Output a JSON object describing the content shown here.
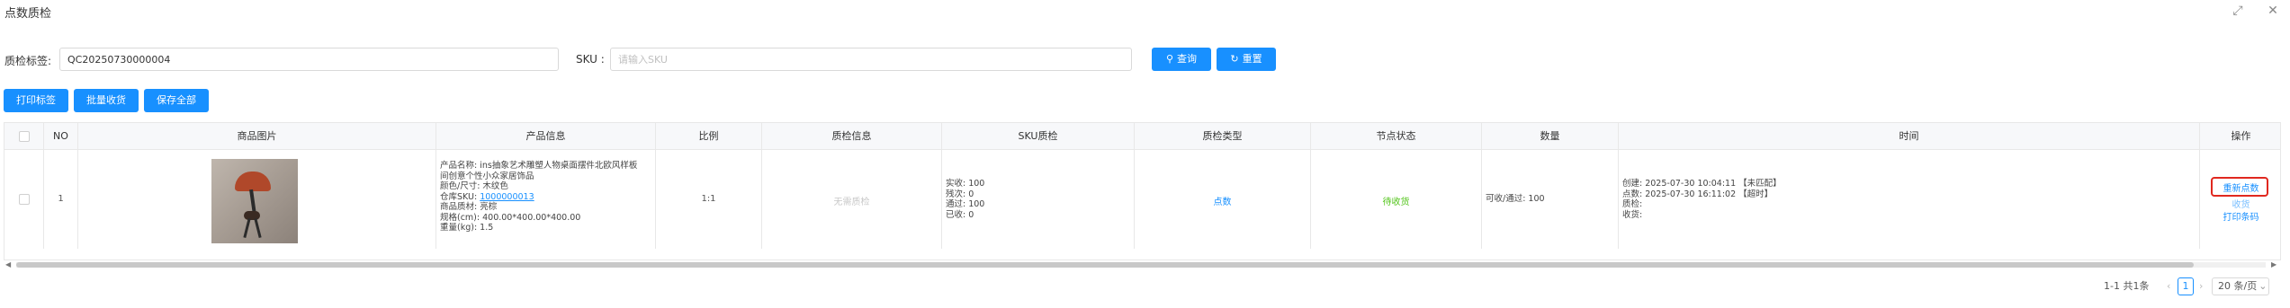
{
  "window": {
    "title": "点数质检",
    "expand_icon": "⤢",
    "close_icon": "✕"
  },
  "search": {
    "label_tag": "质检标签:",
    "tag_value": "QC20250730000004",
    "label_sku": "SKU :",
    "sku_placeholder": "请输入SKU",
    "query_label": "查询",
    "reset_label": "重置"
  },
  "toolbar": {
    "print_label": "打印标签",
    "batch_label": "批量收货",
    "save_label": "保存全部"
  },
  "table": {
    "headers": [
      "",
      "NO",
      "商品图片",
      "产品信息",
      "比例",
      "质检信息",
      "SKU质检",
      "质检类型",
      "节点状态",
      "数量",
      "时间",
      "操作"
    ],
    "rows": [
      {
        "no": "1",
        "info": {
          "name": "产品名称:  ins抽象艺术雕塑人物桌面摆件北欧风样板",
          "name2": "间创意个性小众家居饰品",
          "color": "颜色/尺寸:  木纹色",
          "sku_label": "仓库SKU:",
          "sku_value": "1000000013",
          "material": "商品质材:  亮棕",
          "size": "规格(cm):  400.00*400.00*400.00",
          "weight": "重量(kg):  1.5"
        },
        "ratio": "1:1",
        "qc_info": "无需质检",
        "sku_qc": [
          "实收:  100",
          "残次:  0",
          "通过:  100",
          "已收:  0"
        ],
        "qc_type": "点数",
        "node_status": "待收货",
        "quantity": "可收/通过:  100",
        "times": [
          "创建:  2025-07-30 10:04:11  【未匹配】",
          "点数:  2025-07-30 16:11:02  【超时】",
          "质检:",
          "收货:"
        ],
        "actions": [
          "重新点数",
          "收货",
          "打印条码"
        ]
      }
    ]
  },
  "pagination": {
    "summary": "1-1 共1条",
    "prev": "‹",
    "page": "1",
    "next": "›",
    "page_size": "20 条/页"
  },
  "colors": {
    "primary": "#1890ff",
    "success": "#52c41a",
    "highlight": "#e0281f"
  }
}
